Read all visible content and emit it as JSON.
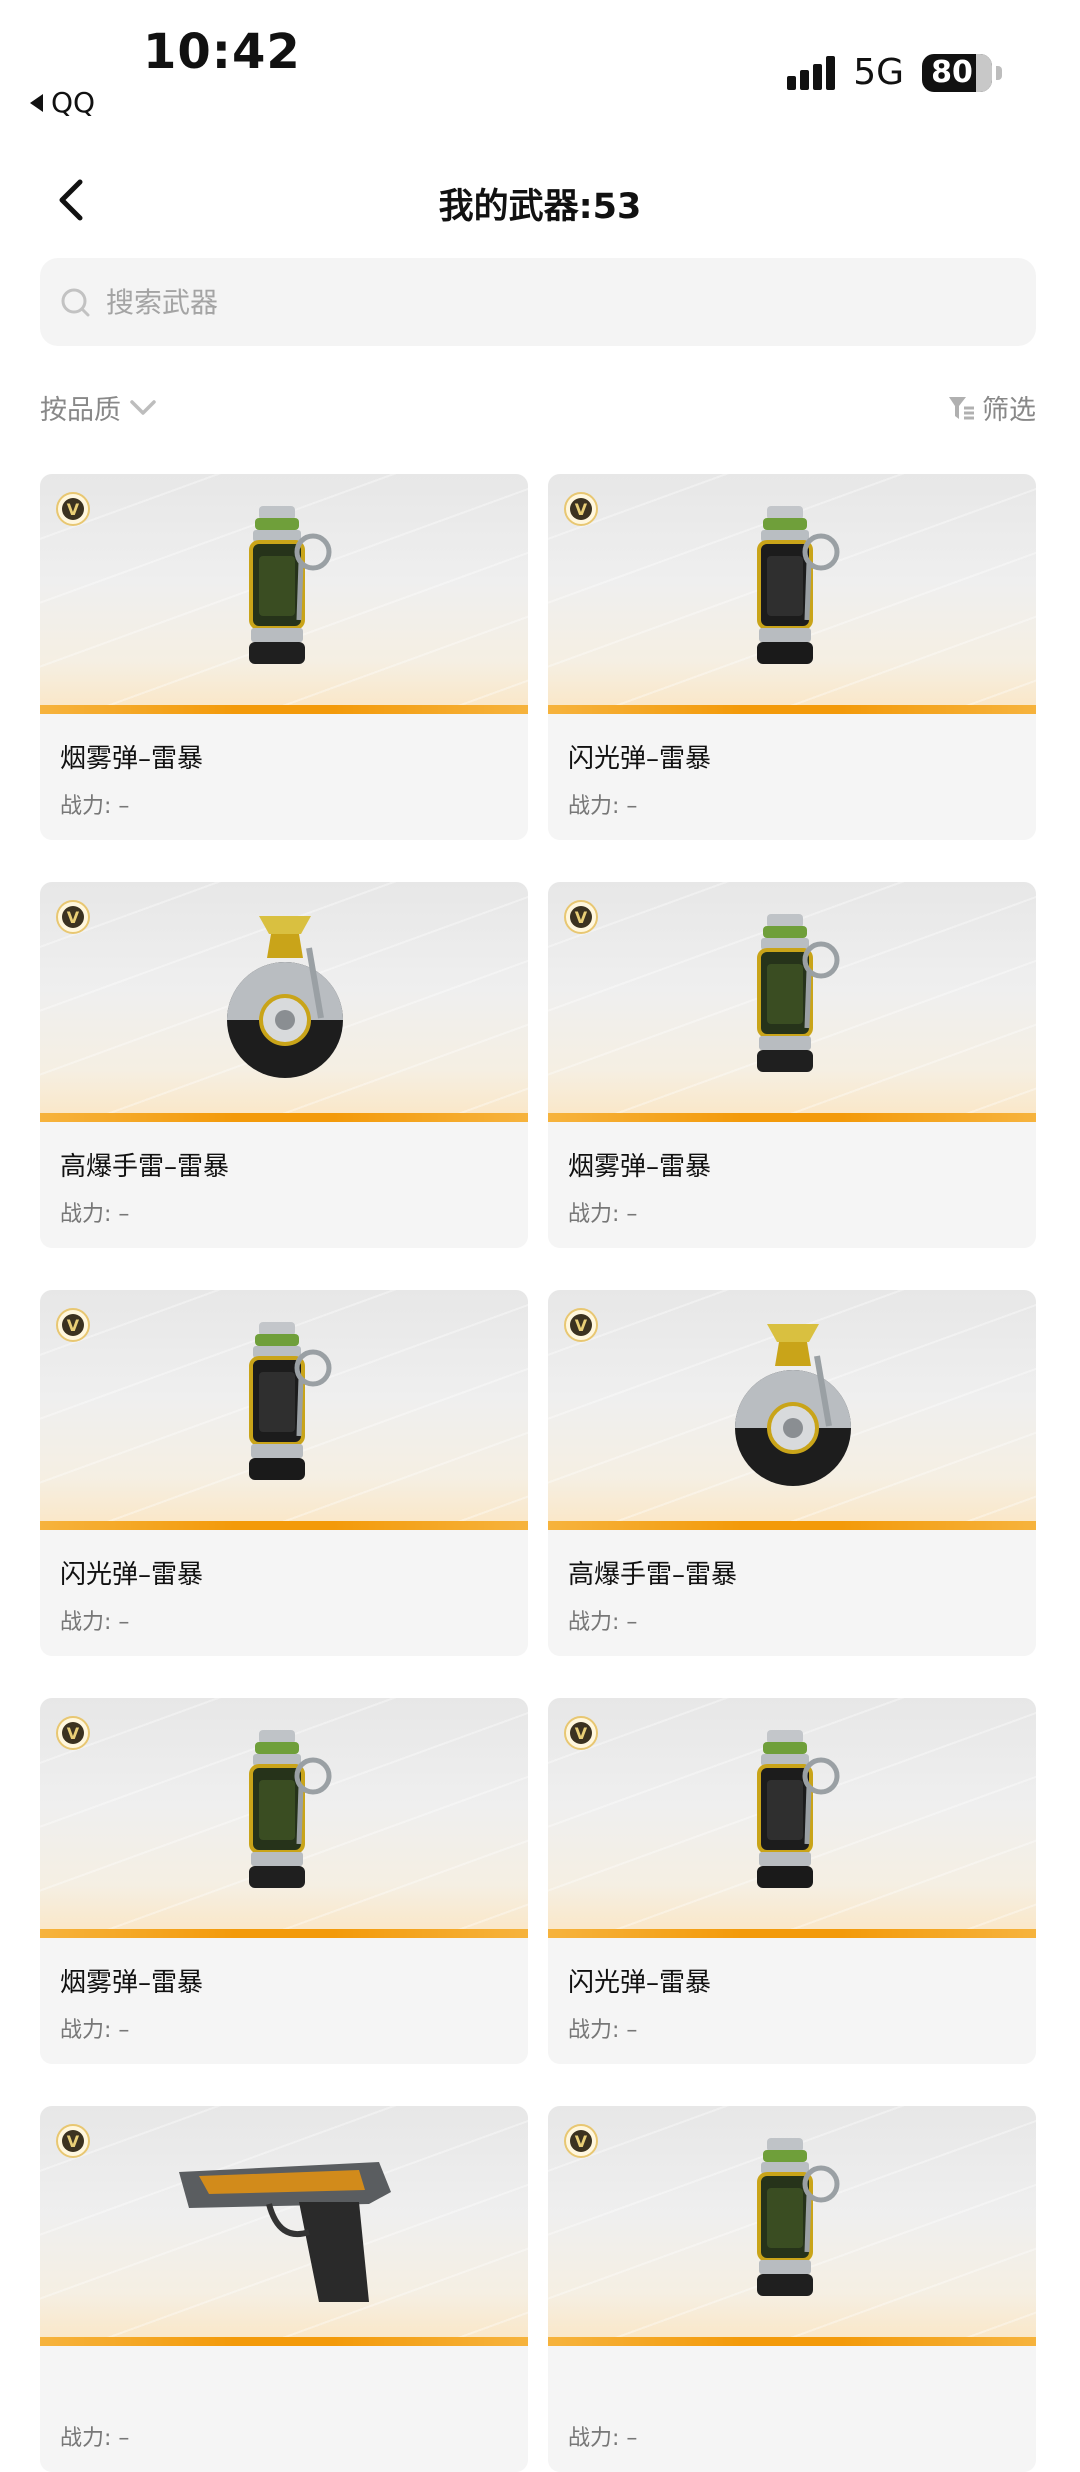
{
  "status": {
    "time": "10:42",
    "back_app": "QQ",
    "network": "5G",
    "battery": "80"
  },
  "header": {
    "title": "我的武器:53"
  },
  "search": {
    "placeholder": "搜索武器"
  },
  "toolbar": {
    "sort_label": "按品质",
    "filter_label": "筛选"
  },
  "power_label": "战力: –",
  "colors": {
    "accent": "#f39a0a",
    "card_bg": "#f5f5f5"
  },
  "weapons": [
    {
      "name": "烟雾弹–雷暴",
      "type": "smoke-grenade"
    },
    {
      "name": "闪光弹–雷暴",
      "type": "flash-grenade"
    },
    {
      "name": "高爆手雷–雷暴",
      "type": "frag-grenade"
    },
    {
      "name": "烟雾弹–雷暴",
      "type": "smoke-grenade"
    },
    {
      "name": "闪光弹–雷暴",
      "type": "flash-grenade"
    },
    {
      "name": "高爆手雷–雷暴",
      "type": "frag-grenade"
    },
    {
      "name": "烟雾弹–雷暴",
      "type": "smoke-grenade"
    },
    {
      "name": "闪光弹–雷暴",
      "type": "flash-grenade"
    },
    {
      "name": "",
      "type": "pistol"
    },
    {
      "name": "",
      "type": "smoke-grenade"
    }
  ]
}
